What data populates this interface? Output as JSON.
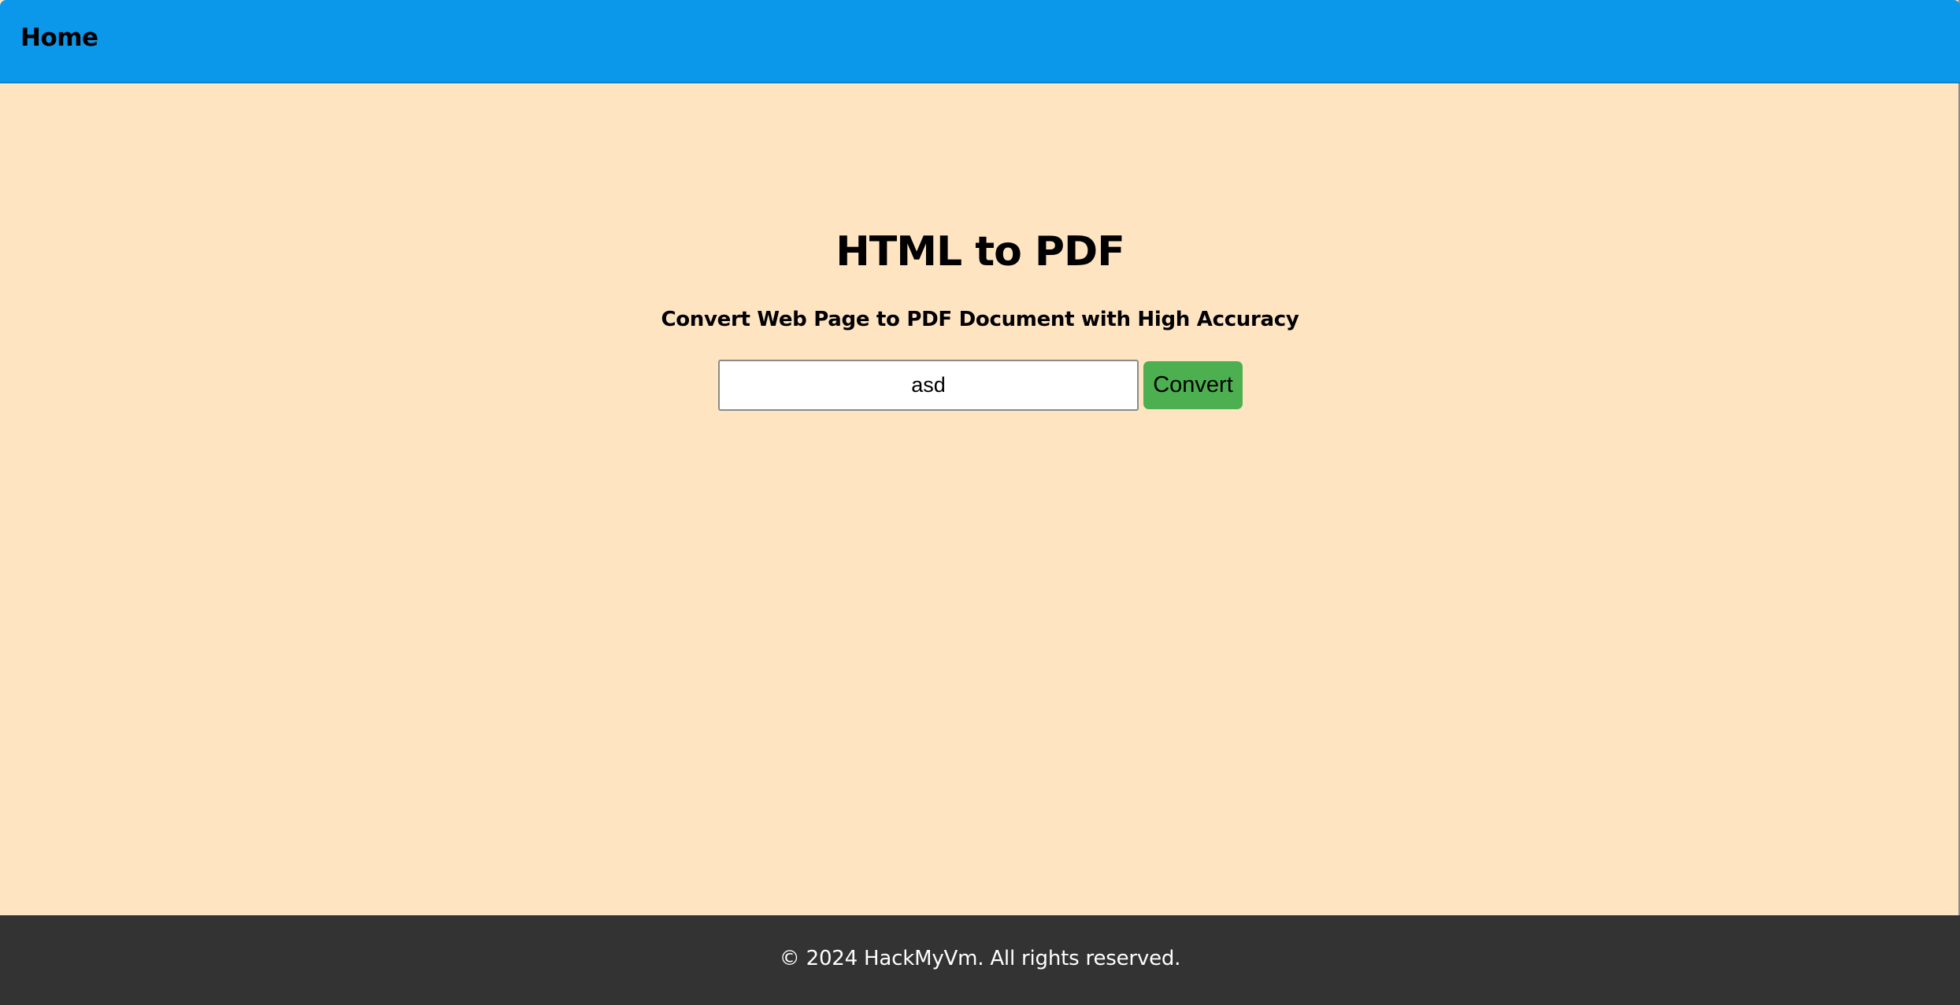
{
  "nav": {
    "home_label": "Home"
  },
  "main": {
    "title": "HTML to PDF",
    "subtitle": "Convert Web Page to PDF Document with High Accuracy",
    "url_input_value": "asd",
    "convert_label": "Convert"
  },
  "footer": {
    "text": "© 2024 HackMyVm. All rights reserved."
  },
  "colors": {
    "topbar": "#0b98ea",
    "background": "#ffe4c2",
    "button": "#4caf50",
    "footer": "#333333"
  }
}
